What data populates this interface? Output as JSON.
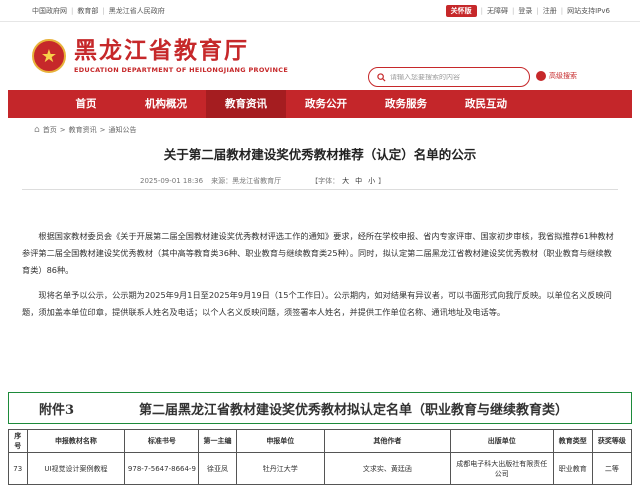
{
  "topbar": {
    "links": [
      "中国政府网",
      "教育部",
      "黑龙江省人民政府"
    ],
    "care_badge": "关怀版",
    "right_links": [
      "无障碍",
      "登录",
      "注册",
      "网站支持IPv6"
    ]
  },
  "header": {
    "title_cn": "黑龙江省教育厅",
    "title_en": "EDUCATION DEPARTMENT OF HEILONGJIANG PROVINCE",
    "search_placeholder": "请输入您要搜索的内容",
    "advanced_search": "高级搜索"
  },
  "nav": {
    "items": [
      "首页",
      "机构概况",
      "教育资讯",
      "政务公开",
      "政务服务",
      "政民互动"
    ],
    "active_index": 2
  },
  "breadcrumb": [
    "首页",
    "教育资讯",
    "通知公告"
  ],
  "article": {
    "title": "关于第二届教材建设奖优秀教材推荐（认定）名单的公示",
    "date": "2025-09-01 18:36",
    "source": "来源：黑龙江省教育厅",
    "font_label": "【字体：",
    "sizes": [
      "大",
      "中",
      "小"
    ],
    "font_close": "】",
    "paragraph1": "根据国家教材委员会《关于开展第二届全国教材建设奖优秀教材评选工作的通知》要求，经所在学校申报、省内专家评审、国家初步审核，我省拟推荐61种教材参评第二届全国教材建设奖优秀教材（其中高等教育类36种、职业教育与继续教育类25种）。同时，拟认定第二届黑龙江省教材建设奖优秀教材（职业教育与继续教育类）86种。",
    "paragraph2": "现将名单予以公示，公示期为2025年9月1日至2025年9月19日（15个工作日）。公示期内，如对结果有异议者，可以书面形式向我厅反映。以单位名义反映问题，须加盖本单位印章，提供联系人姓名及电话；以个人名义反映问题，须签署本人姓名，并提供工作单位名称、通讯地址及电话等。"
  },
  "attachment": {
    "label": "附件3",
    "title": "第二届黑龙江省教材建设奖优秀教材拟认定名单（职业教育与继续教育类）"
  },
  "table": {
    "headers": [
      "序号",
      "申报教材名称",
      "标准书号",
      "第一主编",
      "申报单位",
      "其他作者",
      "出版单位",
      "教育类型",
      "获奖等级"
    ],
    "rows": [
      [
        "73",
        "UI视觉设计案例教程",
        "978-7-5647-8664-9",
        "徐亚凤",
        "牡丹江大学",
        "文求实、黄廷函",
        "成都电子科大出版社有限责任公司",
        "职业教育",
        "二等"
      ]
    ]
  }
}
